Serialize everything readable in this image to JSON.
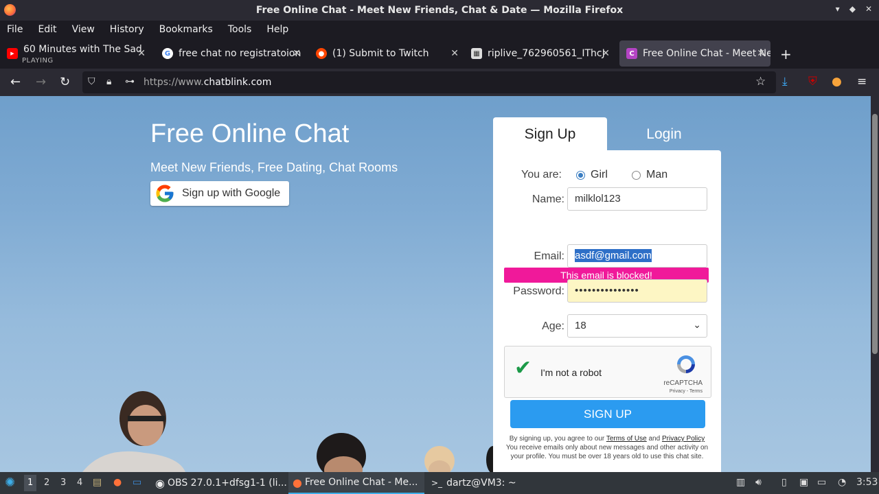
{
  "window": {
    "title": "Free Online Chat - Meet New Friends, Chat & Date — Mozilla Firefox"
  },
  "menu": [
    "File",
    "Edit",
    "View",
    "History",
    "Bookmarks",
    "Tools",
    "Help"
  ],
  "tabs": [
    {
      "label": "60 Minutes with The Sad",
      "sub": "PLAYING",
      "icon": "youtube-icon"
    },
    {
      "label": "free chat no registratoion",
      "icon": "google-icon"
    },
    {
      "label": "(1) Submit to Twitch",
      "icon": "reddit-icon"
    },
    {
      "label": "riplive_762960561_IThcJ",
      "icon": "file-icon"
    },
    {
      "label": "Free Online Chat - Meet New",
      "icon": "chatblink-icon",
      "active": true
    }
  ],
  "url": {
    "protocol": "https://www.",
    "domain": "chatblink.com"
  },
  "toolbar_badges": {
    "ublock": "2",
    "ext": "5"
  },
  "hero": {
    "title": "Free Online Chat",
    "subtitle": "Meet New Friends, Free Dating, Chat Rooms",
    "google_btn": "Sign up with Google"
  },
  "form": {
    "tab_signup": "Sign Up",
    "tab_login": "Login",
    "you_are_label": "You are:",
    "gender_girl": "Girl",
    "gender_man": "Man",
    "gender_selected": "Girl",
    "name_label": "Name:",
    "name_value": "milklol123",
    "error": "This email is blocked!",
    "email_label": "Email:",
    "email_value": "asdf@gmail.com",
    "password_label": "Password:",
    "password_value": "•••••••••••••••",
    "age_label": "Age:",
    "age_value": "18",
    "captcha_label": "I'm not a robot",
    "captcha_brand": "reCAPTCHA",
    "captcha_terms": "Privacy - Terms",
    "submit": "SIGN UP",
    "terms_pre": "By signing up, you agree to our ",
    "terms_link": "Terms of Use",
    "terms_and": " and ",
    "privacy_link": "Privacy Policy",
    "terms_post": " You receive emails only about new messages and other activity on your profile. You must be over 18 years old to use this chat site."
  },
  "taskbar": {
    "desktops": [
      "1",
      "2",
      "3",
      "4"
    ],
    "windows": [
      {
        "label": "OBS 27.0.1+dfsg1-1 (li...",
        "icon": "obs-icon"
      },
      {
        "label": "Free Online Chat - Me...",
        "icon": "firefox-icon",
        "active": true
      },
      {
        "label": "dartz@VM3: ~",
        "icon": "terminal-icon"
      }
    ],
    "clock": "3:53"
  },
  "colors": {
    "error": "#f0199a",
    "signup_btn": "#2b9bf0",
    "accent": "#3daee9"
  }
}
